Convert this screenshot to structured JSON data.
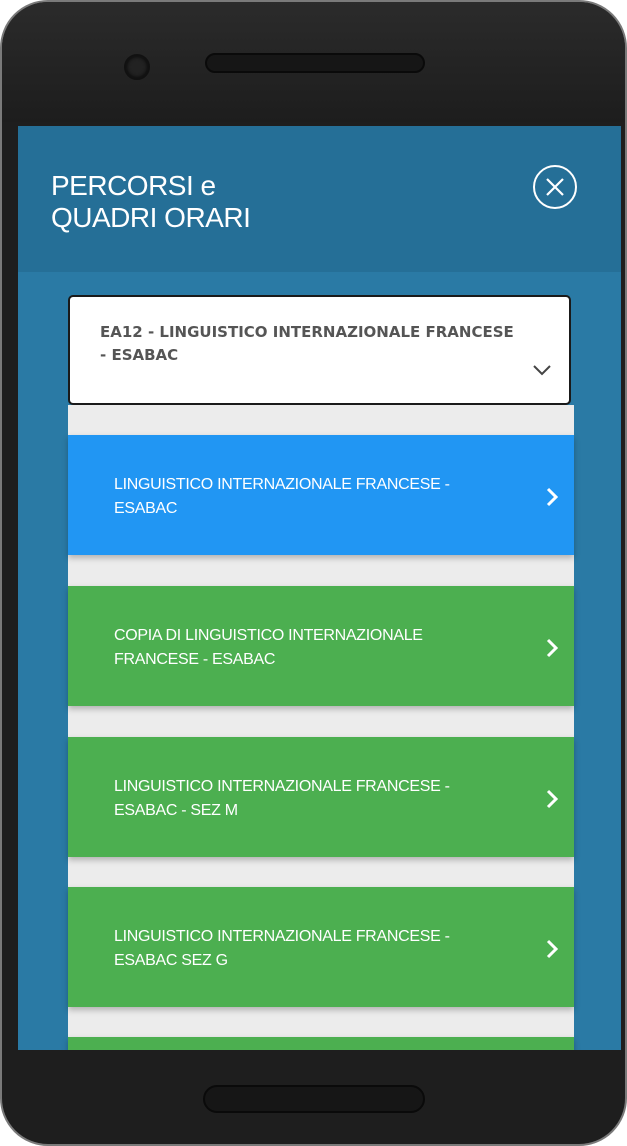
{
  "header": {
    "title": "PERCORSI e\nQUADRI ORARI",
    "close_icon": "close-circle-icon"
  },
  "select": {
    "value": "EA12 - LINGUISTICO INTERNAZIONALE FRANCESE - ESABAC",
    "icon": "chevron-down-icon"
  },
  "courses": [
    {
      "label": "LINGUISTICO INTERNAZIONALE FRANCESE - ESABAC",
      "color": "#2196f3",
      "state": "selected"
    },
    {
      "label": "COPIA DI LINGUISTICO INTERNAZIONALE FRANCESE - ESABAC",
      "color": "#4caf50"
    },
    {
      "label": "LINGUISTICO INTERNAZIONALE FRANCESE - ESABAC - SEZ M",
      "color": "#4caf50"
    },
    {
      "label": "LINGUISTICO INTERNAZIONALE FRANCESE - ESABAC SEZ G",
      "color": "#4caf50"
    },
    {
      "label": "",
      "color": "#4caf50"
    }
  ],
  "colors": {
    "header_bg": "#256f97",
    "screen_bg": "#2a7aa5",
    "selected": "#2196f3",
    "course": "#4caf50"
  }
}
